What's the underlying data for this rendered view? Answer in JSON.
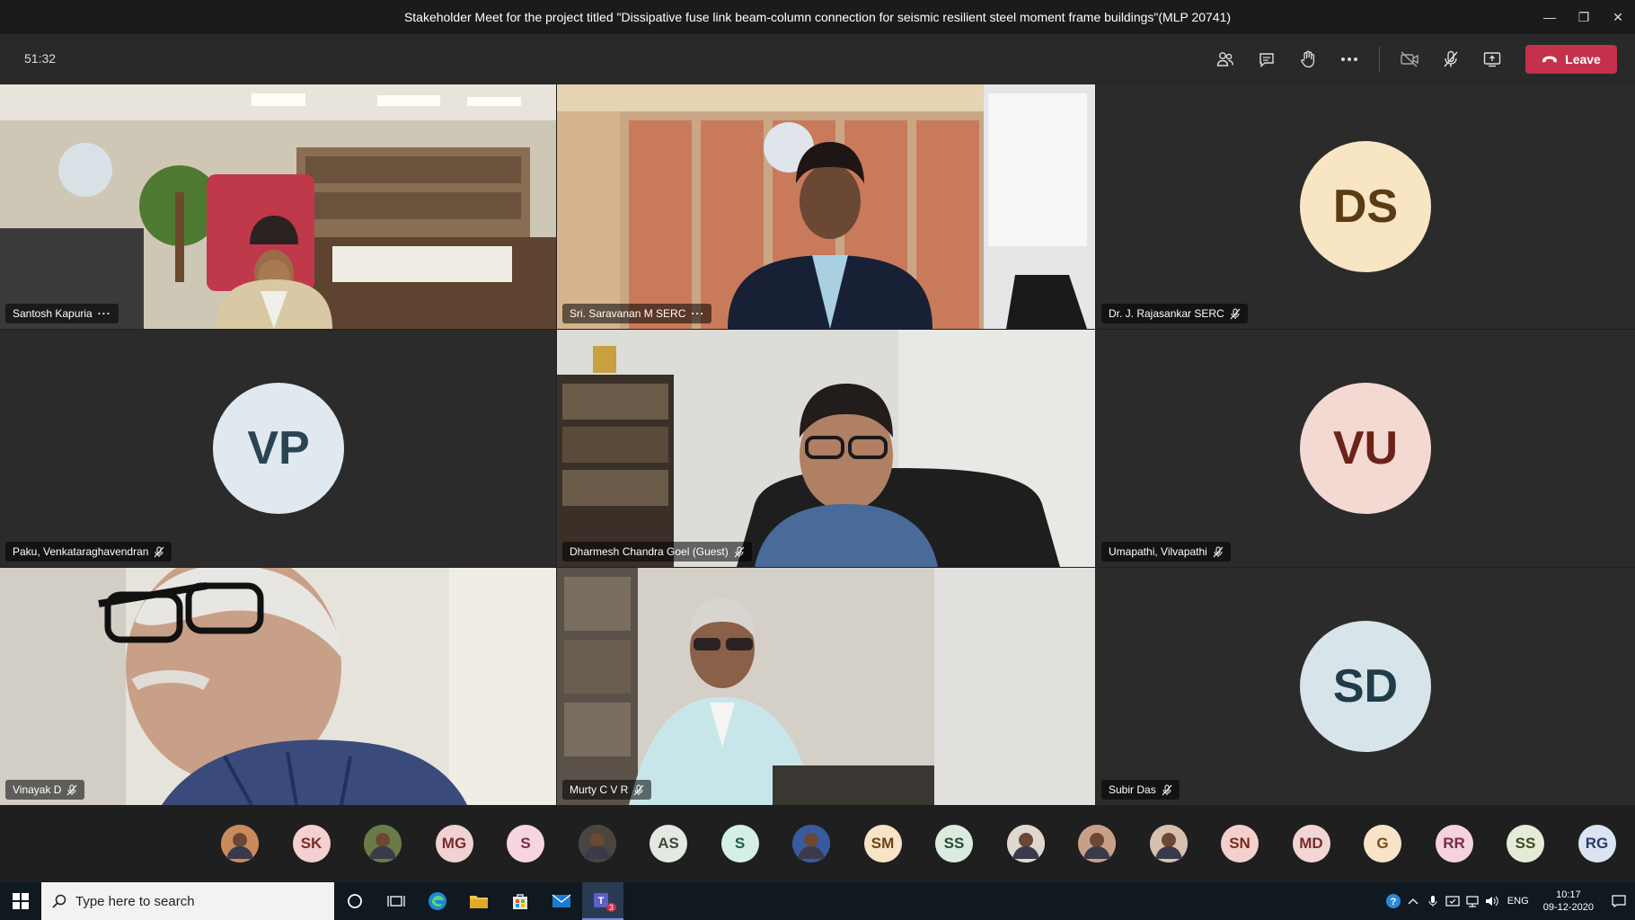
{
  "window": {
    "title": "Stakeholder Meet for the project titled \"Dissipative fuse link beam-column connection for seismic resilient steel moment frame buildings\"(MLP 20741)",
    "minimize": "—",
    "restore": "❐",
    "close": "✕"
  },
  "toolbar": {
    "timer": "51:32",
    "leave_label": "Leave",
    "leave_color": "#c4314b"
  },
  "tiles": [
    {
      "name": "Santosh Kapuria",
      "type": "video",
      "indicator": "more"
    },
    {
      "name": "Sri. Saravanan M SERC",
      "type": "video",
      "indicator": "more"
    },
    {
      "name": "Dr. J. Rajasankar SERC",
      "type": "avatar",
      "initials": "DS",
      "bg": "#f7e5c4",
      "fg": "#5a3b14",
      "indicator": "mic-off"
    },
    {
      "name": "Paku, Venkataraghavendran",
      "type": "avatar",
      "initials": "VP",
      "bg": "#dfe9ef",
      "fg": "#2a4452",
      "indicator": "mic-off"
    },
    {
      "name": "Dharmesh Chandra Goel (Guest)",
      "type": "video",
      "indicator": "mic-off"
    },
    {
      "name": "Umapathi, Vilvapathi",
      "type": "avatar",
      "initials": "VU",
      "bg": "#f4d8d2",
      "fg": "#6b2218",
      "indicator": "mic-off"
    },
    {
      "name": "Vinayak D",
      "type": "video",
      "indicator": "mic-off"
    },
    {
      "name": "Murty C V R",
      "type": "video",
      "indicator": "mic-off"
    },
    {
      "name": "Subir Das",
      "type": "avatar",
      "initials": "SD",
      "bg": "#d7e4ea",
      "fg": "#1f3c48",
      "indicator": "mic-off"
    }
  ],
  "roster": [
    {
      "initials": "",
      "photo": true,
      "bg": "#c98a5c"
    },
    {
      "initials": "SK",
      "bg": "#f4d0d0",
      "fg": "#7a2a2a"
    },
    {
      "initials": "",
      "photo": true,
      "bg": "#6a7b4a"
    },
    {
      "initials": "MG",
      "bg": "#f0d2d2",
      "fg": "#7a2a2a"
    },
    {
      "initials": "S",
      "bg": "#f6d5e0",
      "fg": "#7a2a4a"
    },
    {
      "initials": "",
      "photo": true,
      "bg": "#4a4540"
    },
    {
      "initials": "AS",
      "bg": "#e3e8e0",
      "fg": "#3a4a3a"
    },
    {
      "initials": "S",
      "bg": "#d4efe6",
      "fg": "#1f5a48"
    },
    {
      "initials": "",
      "photo": true,
      "bg": "#3a5aa0"
    },
    {
      "initials": "SM",
      "bg": "#f7e3c8",
      "fg": "#6a4414"
    },
    {
      "initials": "SS",
      "bg": "#dcebe0",
      "fg": "#2a4a34"
    },
    {
      "initials": "",
      "photo": true,
      "bg": "#e0d8d0"
    },
    {
      "initials": "",
      "photo": true,
      "bg": "#c8a088"
    },
    {
      "initials": "",
      "photo": true,
      "bg": "#d8c0b0"
    },
    {
      "initials": "SN",
      "bg": "#f3d0cc",
      "fg": "#7a2a22"
    },
    {
      "initials": "MD",
      "bg": "#f1d6d6",
      "fg": "#7a2a2a"
    },
    {
      "initials": "G",
      "bg": "#f7e3c8",
      "fg": "#7a4e14"
    },
    {
      "initials": "RR",
      "bg": "#f5d3dd",
      "fg": "#7a2a44"
    },
    {
      "initials": "SS",
      "bg": "#e4ecd8",
      "fg": "#3a4a24"
    },
    {
      "initials": "RG",
      "bg": "#dce4f4",
      "fg": "#2a3a6a"
    }
  ],
  "taskbar": {
    "search_placeholder": "Type here to search",
    "teams_badge": "3",
    "language": "ENG",
    "time": "10:17",
    "date": "09-12-2020"
  }
}
